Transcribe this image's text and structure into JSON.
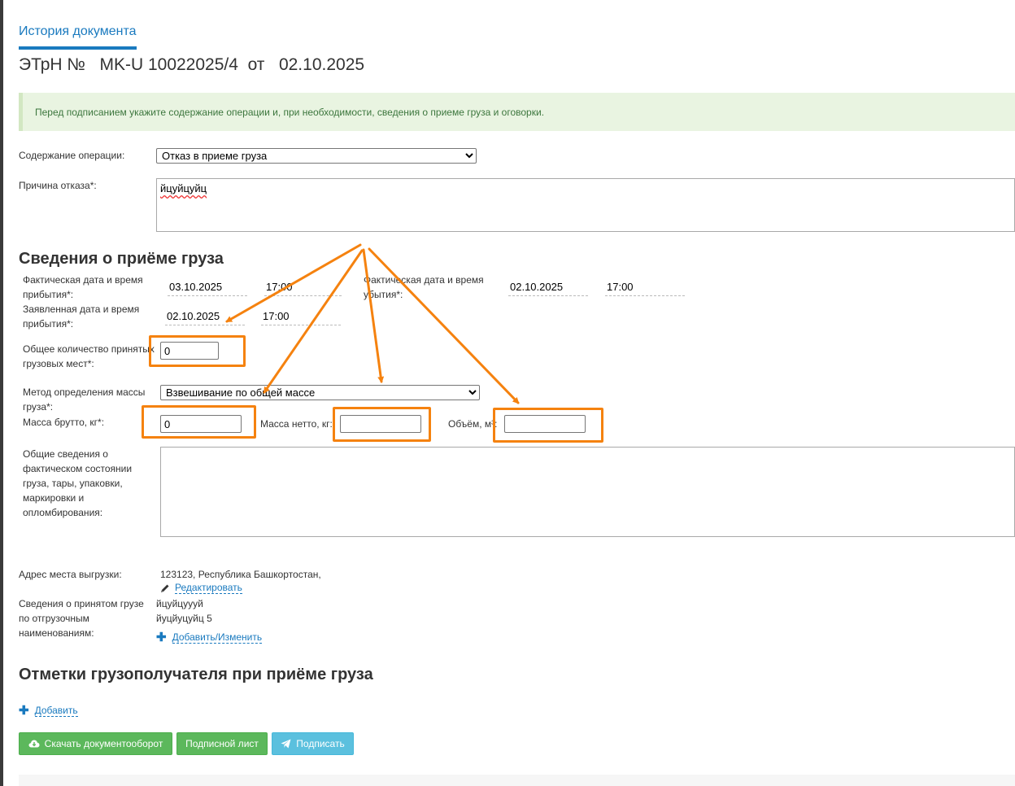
{
  "header": {
    "tab_label": "История документа",
    "doc_prefix": "ЭТрН №",
    "doc_number": "MK-U 10022025/4",
    "doc_from": "от",
    "doc_date": "02.10.2025"
  },
  "alert": {
    "text": "Перед подписанием укажите содержание операции и, при необходимости, сведения о приеме груза и оговорки."
  },
  "operation": {
    "label": "Содержание операции:",
    "value": "Отказ в приеме груза"
  },
  "refusal": {
    "label": "Причина отказа*:",
    "value": "йцуйцуйц"
  },
  "cargo_section": {
    "title": "Сведения о приёме груза",
    "actual_arrival": {
      "label": "Фактическая дата и время прибытия*:",
      "date": "03.10.2025",
      "time": "17:00"
    },
    "actual_departure": {
      "label": "Фактическая дата и время убытия*:",
      "date": "02.10.2025",
      "time": "17:00"
    },
    "declared_arrival": {
      "label": "Заявленная дата и время прибытия*:",
      "date": "02.10.2025",
      "time": "17:00"
    },
    "total_places": {
      "label": "Общее количество принятых грузовых мест*:",
      "value": "0"
    },
    "mass_method": {
      "label": "Метод определения массы груза*:",
      "value": "Взвешивание по общей массе"
    },
    "gross": {
      "label": "Масса брутто, кг*:",
      "value": "0"
    },
    "net": {
      "label": "Масса нетто, кг:",
      "value": ""
    },
    "volume": {
      "label": "Объём, м³:",
      "value": ""
    },
    "general_info": {
      "label": "Общие сведения о фактическом состоянии груза, тары, упаковки, маркировки и опломбирования:",
      "value": ""
    }
  },
  "unload": {
    "label": "Адрес места выгрузки:",
    "value": "123123, Республика Башкортостан,",
    "edit_link": "Редактировать"
  },
  "accepted": {
    "label": "Сведения о принятом грузе по отгрузочным наименованиям:",
    "lines": [
      "йцуйцуууй",
      "йуцйуцуйц 5"
    ],
    "link": "Добавить/Изменить"
  },
  "marks_section": {
    "title": "Отметки грузополучателя при приёме груза",
    "add_link": "Добавить"
  },
  "buttons": {
    "download": "Скачать документооборот",
    "sign_sheet": "Подписной лист",
    "sign": "Подписать"
  },
  "colors": {
    "accent": "#1a7abf",
    "annotation": "#f5820f",
    "btn_green": "#5cb85c",
    "btn_blue": "#5bc0de"
  },
  "icons": [
    "pencil-icon",
    "plus-icon",
    "cloud-download-icon",
    "paper-plane-icon",
    "select-chevron-icon"
  ]
}
